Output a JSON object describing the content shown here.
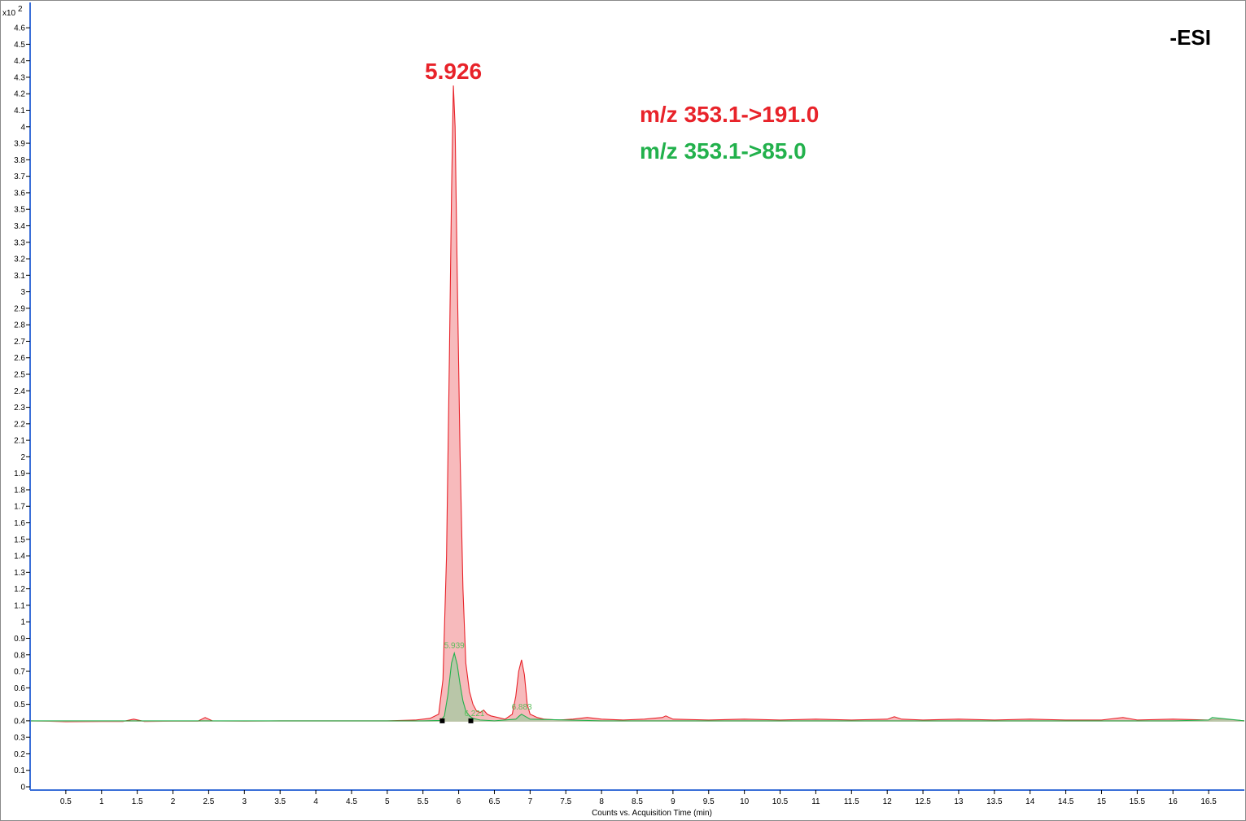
{
  "chart_data": {
    "type": "line",
    "title": "",
    "xlabel": "Counts vs. Acquisition Time (min)",
    "ylabel": "",
    "y_multiplier": "x10",
    "y_exponent": "2",
    "xlim": [
      0,
      17
    ],
    "ylim": [
      0,
      4.7
    ],
    "x_ticks": [
      0.5,
      1,
      1.5,
      2,
      2.5,
      3,
      3.5,
      4,
      4.5,
      5,
      5.5,
      6,
      6.5,
      7,
      7.5,
      8,
      8.5,
      9,
      9.5,
      10,
      10.5,
      11,
      11.5,
      12,
      12.5,
      13,
      13.5,
      14,
      14.5,
      15,
      15.5,
      16,
      16.5
    ],
    "y_ticks": [
      0,
      0.1,
      0.2,
      0.3,
      0.4,
      0.5,
      0.6,
      0.7,
      0.8,
      0.9,
      1,
      1.1,
      1.2,
      1.3,
      1.4,
      1.5,
      1.6,
      1.7,
      1.8,
      1.9,
      2,
      2.1,
      2.2,
      2.3,
      2.4,
      2.5,
      2.6,
      2.7,
      2.8,
      2.9,
      3,
      3.1,
      3.2,
      3.3,
      3.4,
      3.5,
      3.6,
      3.7,
      3.8,
      3.9,
      4,
      4.1,
      4.2,
      4.3,
      4.4,
      4.5,
      4.6
    ],
    "mode_label": "-ESI",
    "legend": [
      {
        "text": "m/z 353.1->191.0",
        "color": "#e8232a"
      },
      {
        "text": "m/z 353.1->85.0",
        "color": "#22b14c"
      }
    ],
    "series": [
      {
        "name": "m/z 353.1->191.0",
        "color": "#e8232a",
        "fill": "#f4a3a6",
        "baseline": 0.395,
        "x": [
          0.0,
          0.5,
          1.0,
          1.3,
          1.45,
          1.6,
          2.0,
          2.35,
          2.45,
          2.55,
          3.0,
          3.5,
          4.0,
          4.5,
          5.0,
          5.4,
          5.6,
          5.72,
          5.78,
          5.83,
          5.87,
          5.9,
          5.926,
          5.95,
          5.98,
          6.02,
          6.06,
          6.1,
          6.15,
          6.2,
          6.25,
          6.3,
          6.35,
          6.4,
          6.45,
          6.55,
          6.65,
          6.75,
          6.8,
          6.84,
          6.88,
          6.92,
          6.96,
          7.0,
          7.05,
          7.1,
          7.2,
          7.4,
          7.6,
          7.8,
          8.0,
          8.3,
          8.6,
          8.85,
          8.9,
          9.0,
          9.5,
          10.0,
          10.5,
          11.0,
          11.5,
          12.0,
          12.1,
          12.2,
          12.5,
          13.0,
          13.5,
          14.0,
          14.5,
          15.0,
          15.3,
          15.5,
          16.0,
          16.5,
          16.7,
          17.0
        ],
        "y": [
          0.4,
          0.395,
          0.396,
          0.396,
          0.41,
          0.396,
          0.398,
          0.398,
          0.42,
          0.4,
          0.398,
          0.4,
          0.4,
          0.4,
          0.4,
          0.405,
          0.415,
          0.44,
          0.65,
          1.4,
          2.6,
          3.6,
          4.25,
          4.0,
          3.1,
          2.0,
          1.2,
          0.75,
          0.58,
          0.5,
          0.46,
          0.45,
          0.465,
          0.44,
          0.43,
          0.42,
          0.41,
          0.44,
          0.55,
          0.7,
          0.77,
          0.68,
          0.5,
          0.44,
          0.43,
          0.42,
          0.41,
          0.405,
          0.41,
          0.42,
          0.41,
          0.405,
          0.41,
          0.42,
          0.43,
          0.41,
          0.405,
          0.41,
          0.405,
          0.41,
          0.405,
          0.41,
          0.425,
          0.41,
          0.405,
          0.41,
          0.405,
          0.41,
          0.405,
          0.405,
          0.42,
          0.405,
          0.41,
          0.405,
          0.41,
          0.4
        ]
      },
      {
        "name": "m/z 353.1->85.0",
        "color": "#22b14c",
        "fill": "#a9c9a3",
        "baseline": 0.395,
        "x": [
          0.0,
          1.0,
          2.0,
          3.0,
          4.0,
          5.0,
          5.5,
          5.75,
          5.8,
          5.85,
          5.9,
          5.939,
          5.98,
          6.02,
          6.06,
          6.1,
          6.15,
          6.2,
          6.25,
          6.3,
          6.5,
          6.8,
          6.85,
          6.88,
          6.92,
          7.0,
          8.0,
          9.0,
          10.0,
          11.0,
          12.0,
          13.0,
          14.0,
          15.0,
          16.0,
          16.5,
          16.55,
          17.0
        ],
        "y": [
          0.4,
          0.4,
          0.4,
          0.4,
          0.4,
          0.4,
          0.4,
          0.402,
          0.43,
          0.56,
          0.75,
          0.81,
          0.74,
          0.62,
          0.52,
          0.46,
          0.43,
          0.415,
          0.41,
          0.405,
          0.4,
          0.41,
          0.43,
          0.44,
          0.43,
          0.41,
          0.4,
          0.4,
          0.4,
          0.4,
          0.4,
          0.4,
          0.4,
          0.4,
          0.4,
          0.405,
          0.42,
          0.4
        ]
      }
    ],
    "peak_labels": [
      {
        "text": "5.926",
        "x": 5.926,
        "y": 4.25,
        "color": "#e8232a",
        "size": "large"
      },
      {
        "text": "5.939",
        "x": 5.939,
        "y": 0.81,
        "color": "#5cbf5c",
        "size": "small"
      },
      {
        "text": "6.221",
        "x": 6.221,
        "y": 0.4,
        "color": "#5cbf5c",
        "size": "small"
      },
      {
        "text": "6.883",
        "x": 6.883,
        "y": 0.44,
        "color": "#5cbf5c",
        "size": "small"
      }
    ],
    "integration_markers": [
      {
        "x": 5.77,
        "y": 0.4
      },
      {
        "x": 6.17,
        "y": 0.4
      }
    ]
  }
}
